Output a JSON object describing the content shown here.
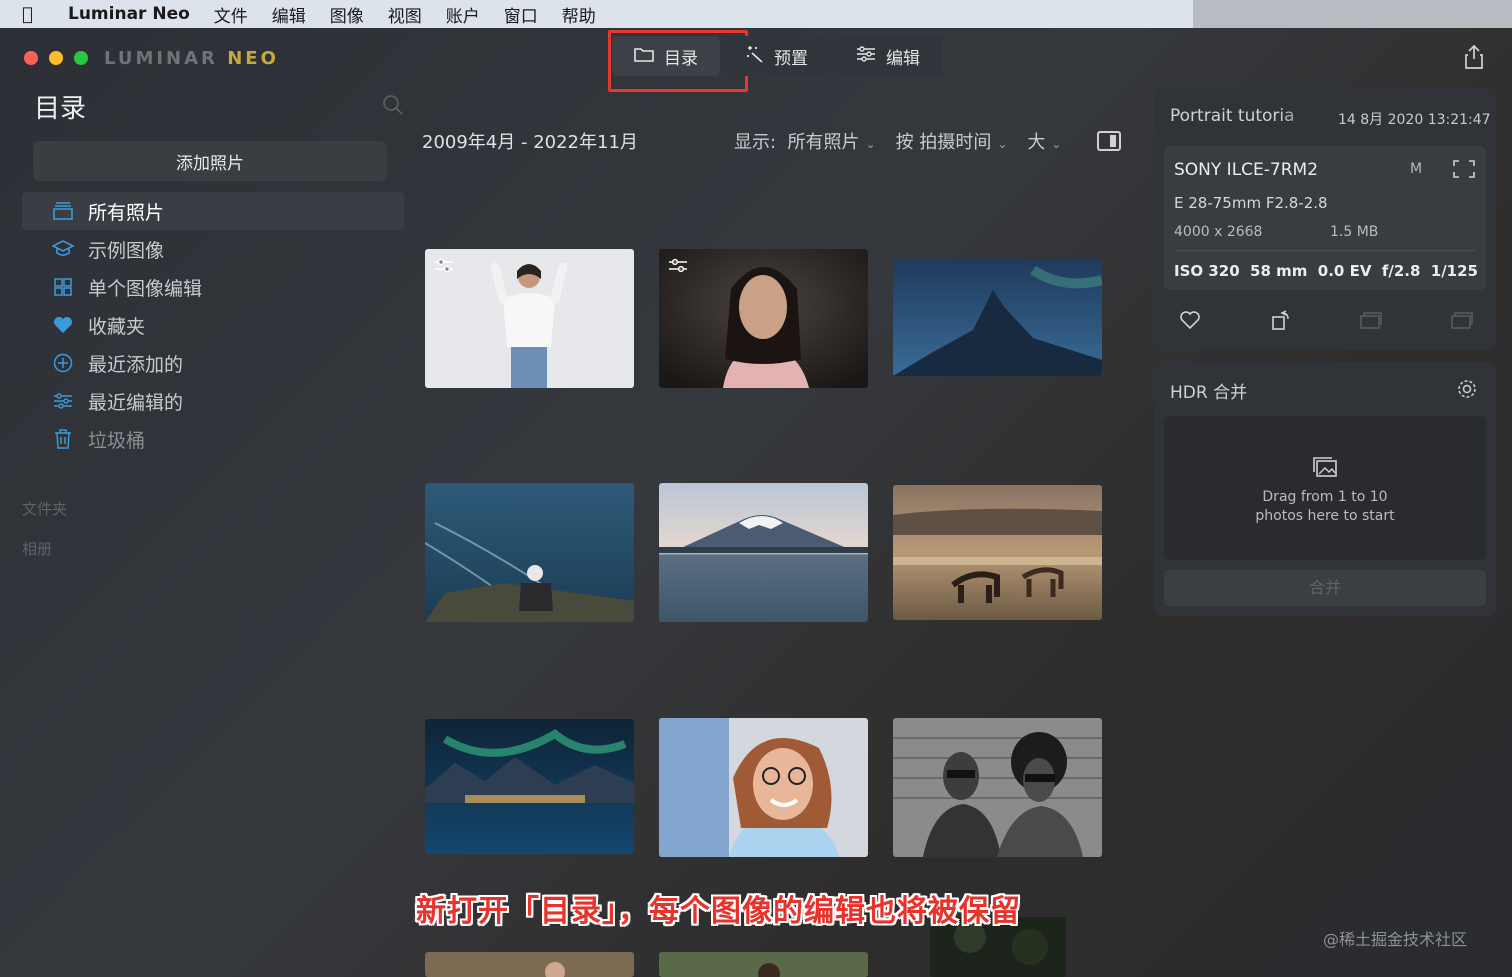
{
  "menubar": {
    "app_name": "Luminar Neo",
    "items": [
      "文件",
      "编辑",
      "图像",
      "视图",
      "账户",
      "窗口",
      "帮助"
    ]
  },
  "logo": {
    "main": "LUMINAR",
    "suffix": "NEO"
  },
  "top_tabs": [
    {
      "label": "目录",
      "icon": "folder-icon",
      "active": true
    },
    {
      "label": "预置",
      "icon": "magic-wand-icon",
      "active": false
    },
    {
      "label": "编辑",
      "icon": "sliders-icon",
      "active": false
    }
  ],
  "sidebar": {
    "title": "目录",
    "add_button": "添加照片",
    "items": [
      {
        "label": "所有照片",
        "icon": "stack-icon",
        "active": true
      },
      {
        "label": "示例图像",
        "icon": "graduation-cap-icon"
      },
      {
        "label": "单个图像编辑",
        "icon": "grid-icon"
      },
      {
        "label": "收藏夹",
        "icon": "heart-icon"
      },
      {
        "label": "最近添加的",
        "icon": "plus-circle-icon"
      },
      {
        "label": "最近编辑的",
        "icon": "sliders-icon"
      },
      {
        "label": "垃圾桶",
        "icon": "trash-icon"
      }
    ],
    "sections": [
      "文件夹",
      "相册"
    ]
  },
  "content": {
    "date_range": "2009年4月 - 2022年11月",
    "filter_show_label": "显示:",
    "filter_show_value": "所有照片",
    "sort_label": "按 拍摄时间",
    "size_label": "大"
  },
  "info_panel": {
    "title": "Portrait tutoria",
    "date": "14 8月 2020 13:21:47",
    "camera": "SONY ILCE-7RM2",
    "mode": "M",
    "lens": "E 28-75mm F2.8-2.8",
    "resolution": "4000 x 2668",
    "file_size": "1.5 MB",
    "exif": [
      "ISO 320",
      "58 mm",
      "0.0 EV",
      "f/2.8",
      "1/125"
    ]
  },
  "hdr_panel": {
    "title": "HDR 合并",
    "drop_text": "Drag from 1 to 10\nphotos here to start",
    "merge_button": "合并"
  },
  "caption": "新打开「目录」，每个图像的编辑也将被保留",
  "watermark": "@稀土掘金技术社区",
  "colors": {
    "accent": "#3a9bdc",
    "highlight": "#e5382e",
    "brand": "#c7a83f"
  }
}
